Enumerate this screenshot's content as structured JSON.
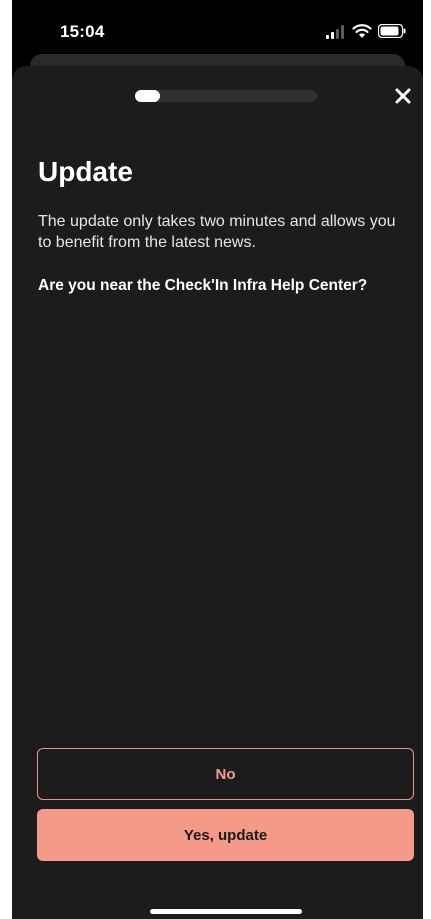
{
  "status_bar": {
    "time": "15:04"
  },
  "header": {
    "progress_fraction": 0.14,
    "close_icon": "close-icon"
  },
  "content": {
    "title": "Update",
    "description": "The update only takes two minutes and allows you to benefit from the latest news.",
    "question": "Are you near the Check'In Infra Help Center?"
  },
  "actions": {
    "no_label": "No",
    "yes_label": "Yes, update"
  },
  "colors": {
    "accent": "#f59a88",
    "background": "#1c1c1c",
    "outline": "#e8958a"
  }
}
